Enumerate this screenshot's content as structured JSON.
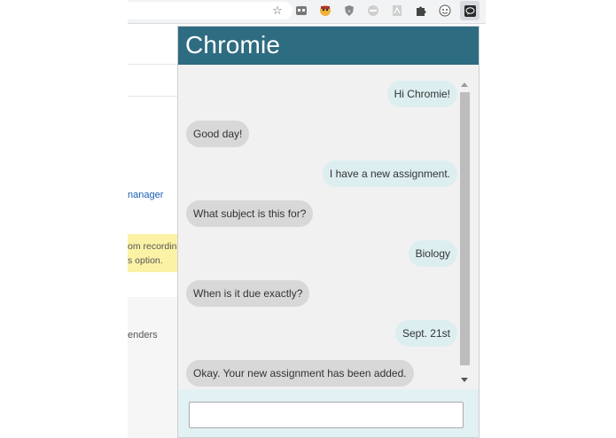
{
  "browser": {
    "toolbar_icons": [
      "star-icon",
      "extension-icon",
      "extension-icon",
      "shield-icon",
      "extension-icon",
      "pdf-icon",
      "puzzle-icon",
      "face-icon",
      "chat-icon"
    ]
  },
  "background_page": {
    "link_text": "nanager",
    "notice_line1": "om recording",
    "notice_line2": "s option.",
    "section_text": "enders"
  },
  "popup": {
    "title": "Chromie",
    "messages": [
      {
        "sender": "user",
        "text": "Hi Chromie!"
      },
      {
        "sender": "bot",
        "text": "Good day!"
      },
      {
        "sender": "user",
        "text": "I have a new assignment."
      },
      {
        "sender": "bot",
        "text": "What subject is this for?"
      },
      {
        "sender": "user",
        "text": "Biology"
      },
      {
        "sender": "bot",
        "text": "When is it due exactly?"
      },
      {
        "sender": "user",
        "text": "Sept. 21st"
      },
      {
        "sender": "bot",
        "text": "Okay. Your new assignment has been added."
      }
    ],
    "input": {
      "value": "",
      "placeholder": ""
    }
  },
  "colors": {
    "header": "#2e6c82",
    "user_bubble": "#ddeef0",
    "bot_bubble": "#d8d8d8",
    "input_area": "#e2f1f3"
  }
}
